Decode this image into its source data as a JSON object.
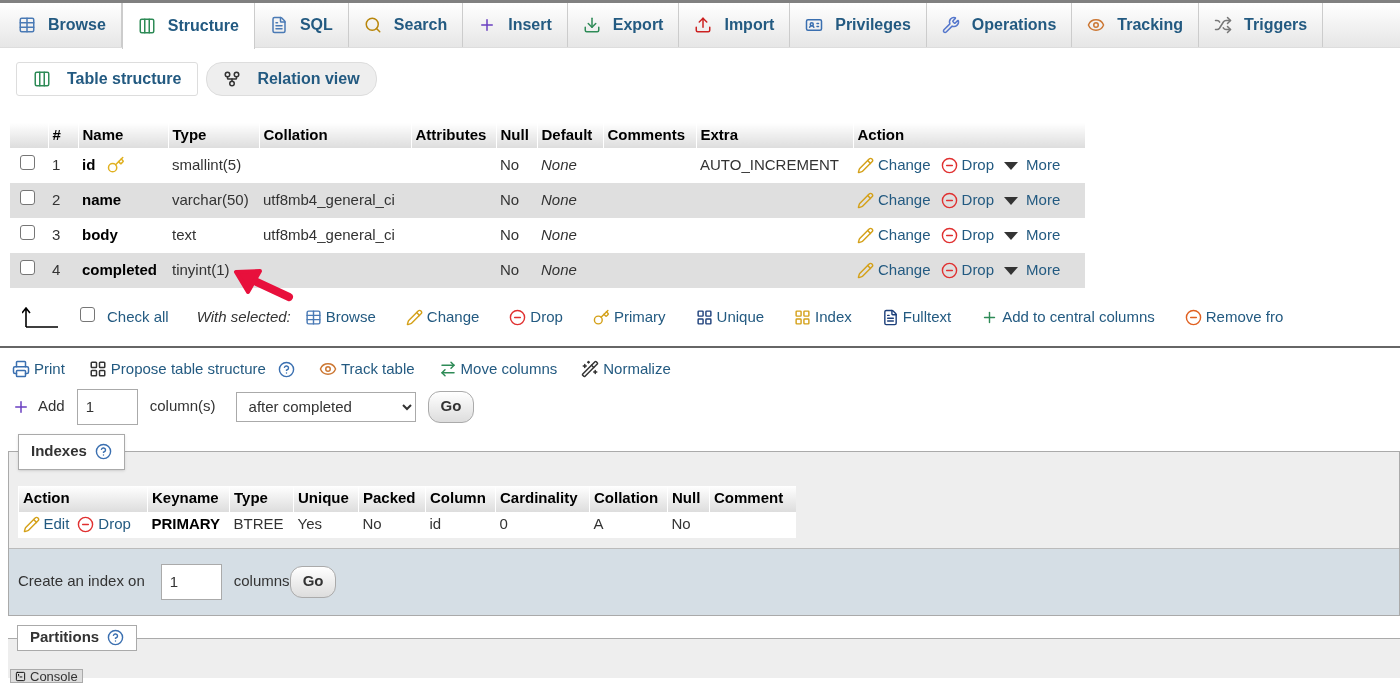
{
  "tabs": [
    {
      "label": "Browse",
      "selected": false
    },
    {
      "label": "Structure",
      "selected": true
    },
    {
      "label": "SQL",
      "selected": false
    },
    {
      "label": "Search",
      "selected": false
    },
    {
      "label": "Insert",
      "selected": false
    },
    {
      "label": "Export",
      "selected": false
    },
    {
      "label": "Import",
      "selected": false
    },
    {
      "label": "Privileges",
      "selected": false
    },
    {
      "label": "Operations",
      "selected": false
    },
    {
      "label": "Tracking",
      "selected": false
    },
    {
      "label": "Triggers",
      "selected": false
    }
  ],
  "subtabs": [
    {
      "label": "Table structure",
      "selected": true
    },
    {
      "label": "Relation view",
      "selected": false
    }
  ],
  "structure_table": {
    "columns": [
      "#",
      "Name",
      "Type",
      "Collation",
      "Attributes",
      "Null",
      "Default",
      "Comments",
      "Extra",
      "Action"
    ],
    "rows": [
      {
        "checked": false,
        "number": "1",
        "name": "id",
        "primary": true,
        "type": "smallint(5)",
        "null": "No",
        "default": "None",
        "extra": "AUTO_INCREMENT",
        "actions": [
          "Change",
          "Drop",
          "More"
        ]
      },
      {
        "checked": false,
        "number": "2",
        "name": "name",
        "primary": false,
        "type": "varchar(50)",
        "collation": "utf8mb4_general_ci",
        "null": "No",
        "default": "None",
        "actions": [
          "Change",
          "Drop",
          "More"
        ]
      },
      {
        "checked": false,
        "number": "3",
        "name": "body",
        "primary": false,
        "type": "text",
        "collation": "utf8mb4_general_ci",
        "null": "No",
        "default": "None",
        "actions": [
          "Change",
          "Drop",
          "More"
        ]
      },
      {
        "checked": false,
        "number": "4",
        "name": "completed",
        "primary": false,
        "type": "tinyint(1)",
        "null": "No",
        "default": "None",
        "actions": [
          "Change",
          "Drop",
          "More"
        ]
      }
    ]
  },
  "bulk_actions": {
    "check_all": {
      "label": "Check all",
      "checked": false
    },
    "with_selected": "With selected:",
    "actions": [
      "Browse",
      "Change",
      "Drop",
      "Primary",
      "Unique",
      "Index",
      "Fulltext",
      "Add to central columns",
      "Remove fro"
    ]
  },
  "tools": [
    {
      "label": "Print",
      "help": false
    },
    {
      "label": "Propose table structure",
      "help": true
    },
    {
      "label": "Track table",
      "help": false
    },
    {
      "label": "Move columns",
      "help": false
    },
    {
      "label": "Normalize",
      "help": false
    }
  ],
  "add_column": {
    "label": "Add",
    "count": "1",
    "unit": "column(s)",
    "position": "after completed",
    "button": "Go"
  },
  "indexes": {
    "legend": "Indexes",
    "columns": [
      "Action",
      "Keyname",
      "Type",
      "Unique",
      "Packed",
      "Column",
      "Cardinality",
      "Collation",
      "Null",
      "Comment"
    ],
    "rows": [
      {
        "actions": [
          "Edit",
          "Drop"
        ],
        "keyname": "PRIMARY",
        "type": "BTREE",
        "unique": "Yes",
        "packed": "No",
        "column": "id",
        "cardinality": "0",
        "collation": "A",
        "null": "No"
      }
    ],
    "create": {
      "label": "Create an index on",
      "count": "1",
      "unit": "columns",
      "button": "Go"
    }
  },
  "partitions": {
    "legend": "Partitions"
  },
  "console": {
    "label": "Console"
  }
}
